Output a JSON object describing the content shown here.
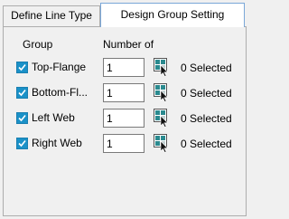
{
  "tabs": [
    {
      "label": "Define Line Type",
      "active": false
    },
    {
      "label": "Design Group Setting",
      "active": true
    }
  ],
  "headers": {
    "group": "Group",
    "number": "Number of"
  },
  "rows": [
    {
      "label": "Top-Flange",
      "checked": true,
      "value": "1",
      "selected": "0 Selected"
    },
    {
      "label": "Bottom-Fl...",
      "checked": true,
      "value": "1",
      "selected": "0 Selected"
    },
    {
      "label": "Left Web",
      "checked": true,
      "value": "1",
      "selected": "0 Selected"
    },
    {
      "label": "Right Web",
      "checked": true,
      "value": "1",
      "selected": "0 Selected"
    }
  ],
  "colors": {
    "checkbox": "#1a91c8",
    "tab_active_border": "#7aa7d8",
    "icon_teal": "#2a8a8f"
  }
}
